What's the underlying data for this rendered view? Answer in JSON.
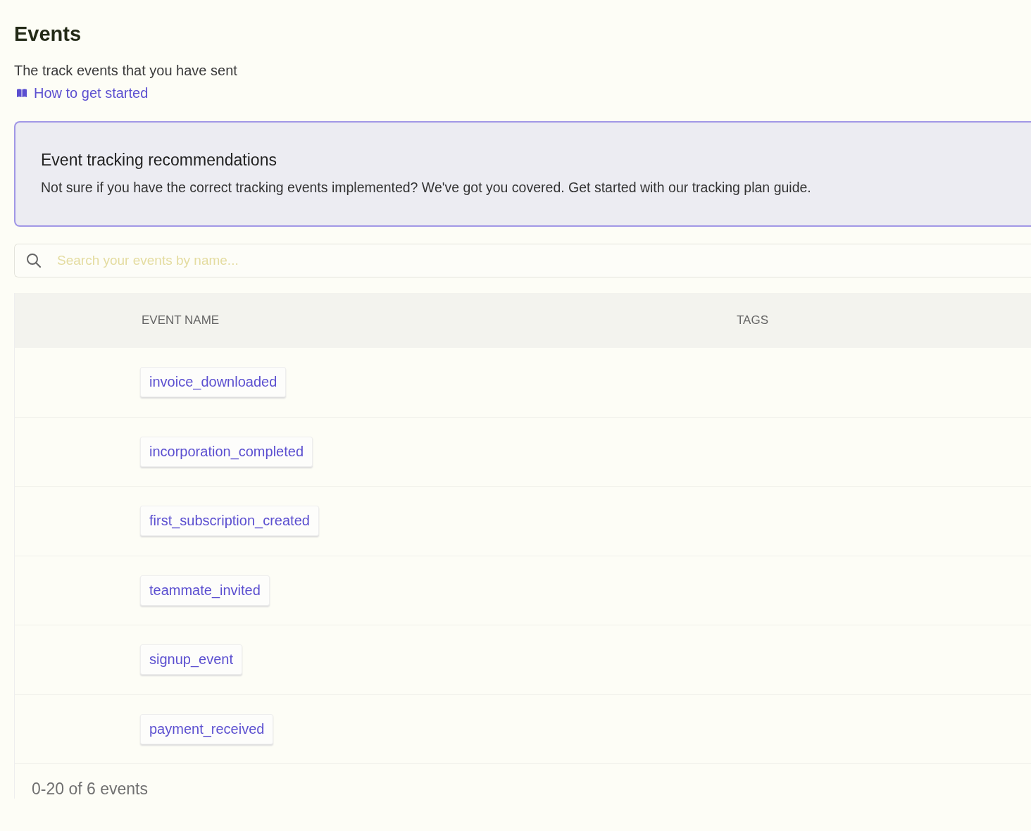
{
  "page": {
    "title": "Events",
    "subtitle": "The track events that you have sent",
    "help_link": "How to get started"
  },
  "recommendation": {
    "title": "Event tracking recommendations",
    "body": "Not sure if you have the correct tracking events implemented? We've got you covered. Get started with our tracking plan guide."
  },
  "search": {
    "placeholder": "Search your events by name..."
  },
  "table": {
    "columns": [
      "EVENT NAME",
      "TAGS"
    ],
    "rows": [
      {
        "event_name": "invoice_downloaded"
      },
      {
        "event_name": "incorporation_completed"
      },
      {
        "event_name": "first_subscription_created"
      },
      {
        "event_name": "teammate_invited"
      },
      {
        "event_name": "signup_event"
      },
      {
        "event_name": "payment_received"
      }
    ]
  },
  "pagination": "0-20 of 6 events"
}
